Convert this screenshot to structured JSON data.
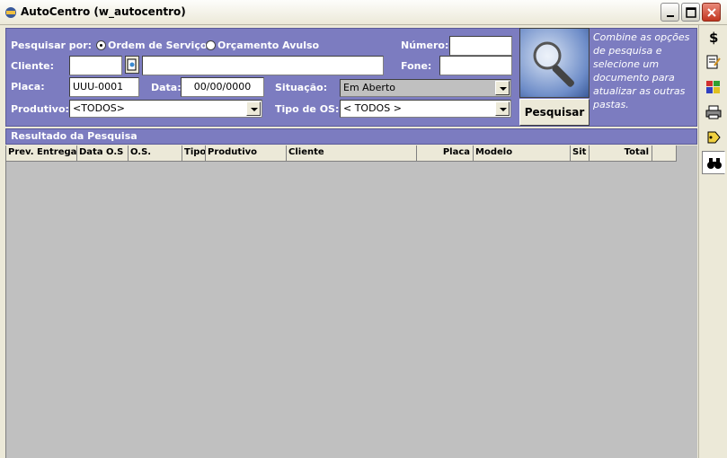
{
  "window": {
    "title": "AutoCentro (w_autocentro)"
  },
  "search": {
    "search_by_label": "Pesquisar por:",
    "radio_service_order": "Ordem de Serviço",
    "radio_quote": "Orçamento Avulso",
    "number_label": "Número:",
    "number_value": "",
    "client_label": "Cliente:",
    "client_code": "",
    "client_name": "",
    "phone_label": "Fone:",
    "phone_value": "",
    "plate_label": "Placa:",
    "plate_value": "UUU-0001",
    "date_label": "Data:",
    "date_value": "00/00/0000",
    "status_label": "Situação:",
    "status_value": "Em Aberto",
    "product_label": "Produtivo:",
    "product_value": "<TODOS>",
    "os_type_label": "Tipo de OS:",
    "os_type_value": "< TODOS >",
    "search_button": "Pesquisar",
    "hint": "Combine as opções de pesquisa e selecione um documento para atualizar as outras pastas."
  },
  "results": {
    "title": "Resultado da Pesquisa",
    "columns": [
      "Prev. Entrega",
      "Data O.S",
      "O.S.",
      "Tipo",
      "Produtivo",
      "Cliente",
      "Placa",
      "Modelo",
      "Sit",
      "Total"
    ]
  },
  "toolbar": {
    "icons": [
      "dollar-icon",
      "edit-document-icon",
      "people-icon",
      "printer-icon",
      "tag-icon",
      "binoculars-icon"
    ]
  },
  "colors": {
    "panel": "#7c7cc0",
    "grid": "#c0c0c0"
  }
}
